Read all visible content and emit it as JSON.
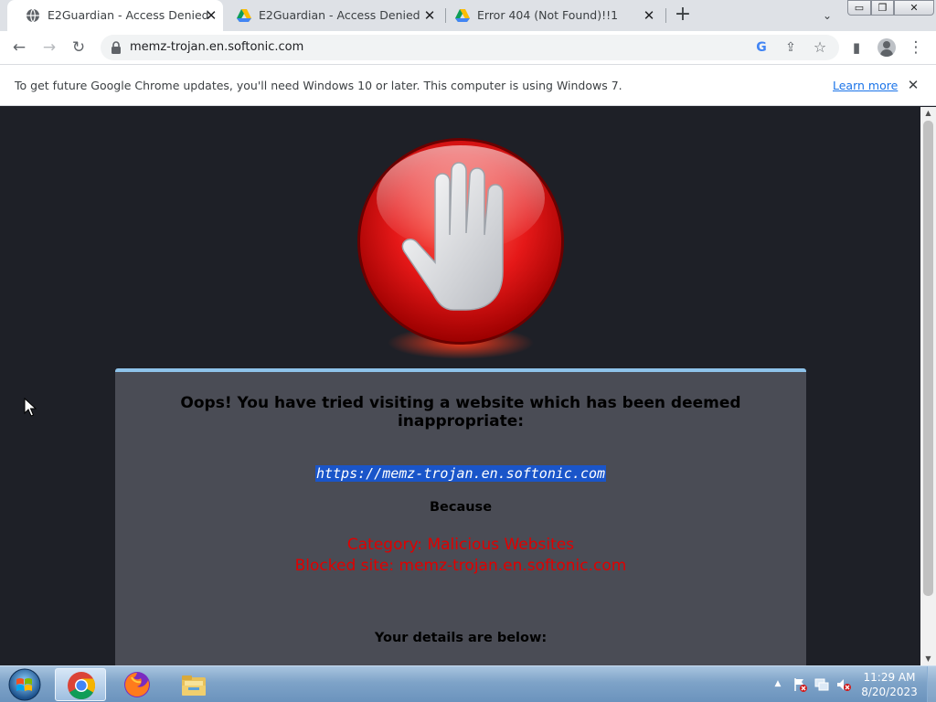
{
  "browser": {
    "tabs": [
      {
        "title": "E2Guardian - Access Denied",
        "close": "✕",
        "active": true
      },
      {
        "title": "E2Guardian - Access Denied",
        "close": "✕",
        "active": false
      },
      {
        "title": "Error 404 (Not Found)!!1",
        "close": "✕",
        "active": false
      }
    ],
    "new_tab": "+",
    "tab_search": "⌄",
    "window_controls": {
      "minimize": "▭",
      "maximize": "❐",
      "close": "✕"
    }
  },
  "toolbar": {
    "back": "←",
    "forward": "→",
    "reload": "↻",
    "url": "memz-trojan.en.softonic.com",
    "google_icon": "G",
    "share_icon": "⇪",
    "bookmark_icon": "☆",
    "sidepanel_icon": "▮",
    "menu_icon": "⋮"
  },
  "infobar": {
    "message": "To get future Google Chrome updates, you'll need Windows 10 or later. This computer is using Windows 7.",
    "link": "Learn more",
    "close": "✕"
  },
  "page": {
    "heading": "Oops! You have tried visiting a website which has been deemed inappropriate:",
    "blocked_url": "https://memz-trojan.en.softonic.com",
    "because": "Because",
    "category": "Category: Malicious Websites",
    "blocked_site": "Blocked site: memz-trojan.en.softonic.com",
    "details": "Your details are below:"
  },
  "scrollbar": {
    "up": "▲",
    "down": "▼"
  },
  "taskbar": {
    "tray_expand": "▲",
    "time": "11:29 AM",
    "date": "8/20/2023"
  },
  "colors": {
    "page_bg": "#1e2027",
    "card_bg": "#4a4c55",
    "card_accent": "#8ec3ea",
    "reason_red": "#e00000",
    "link_blue": "#1a73e8"
  }
}
